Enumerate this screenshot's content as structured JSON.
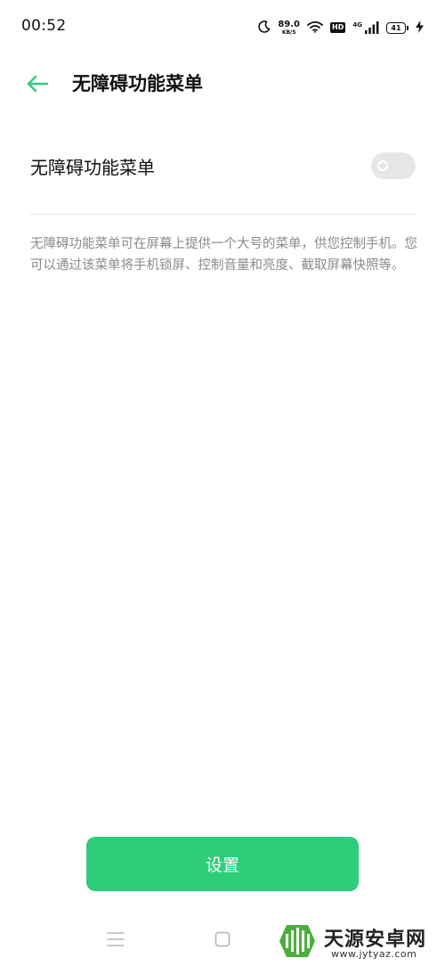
{
  "status_bar": {
    "time": "00:52",
    "net_speed": "89.0",
    "net_unit": "KB/S",
    "hd": "HD",
    "network": "4G",
    "battery": "41"
  },
  "header": {
    "title": "无障碍功能菜单"
  },
  "setting": {
    "label": "无障碍功能菜单",
    "enabled": false
  },
  "description": "无障碍功能菜单可在屏幕上提供一个大号的菜单，供您控制手机。您可以通过该菜单将手机锁屏、控制音量和亮度、截取屏幕快照等。",
  "settings_button": {
    "label": "设置"
  },
  "watermark": {
    "name": "天源安卓网",
    "url": "www.jytyaz.com"
  },
  "colors": {
    "accent": "#2ecd7a",
    "toggle_off": "#e6e6e6",
    "secondary_text": "#8a8a8a"
  },
  "icons": {
    "back": "arrow-left-icon",
    "moon": "moon-icon",
    "wifi": "wifi-icon",
    "signal": "signal-icon",
    "battery": "battery-icon",
    "charging": "charging-icon",
    "nav_menu": "menu-lines-icon",
    "nav_home": "square-home-icon"
  }
}
